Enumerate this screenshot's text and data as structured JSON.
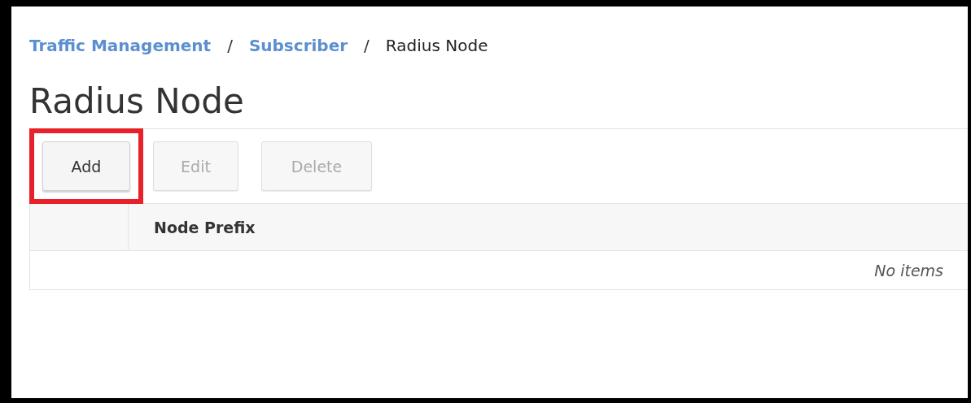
{
  "breadcrumb": [
    {
      "label": "Traffic Management",
      "kind": "link"
    },
    {
      "label": "Subscriber",
      "kind": "link"
    },
    {
      "label": "Radius Node",
      "kind": "current"
    }
  ],
  "breadcrumb_separator": "/",
  "title": "Radius Node",
  "buttons": [
    {
      "label": "Add",
      "disabled": false,
      "highlighted": true
    },
    {
      "label": "Edit",
      "disabled": true,
      "highlighted": false
    },
    {
      "label": "Delete",
      "disabled": true,
      "highlighted": false
    }
  ],
  "table": {
    "columns": [
      "Node Prefix"
    ],
    "empty_message": "No items"
  }
}
